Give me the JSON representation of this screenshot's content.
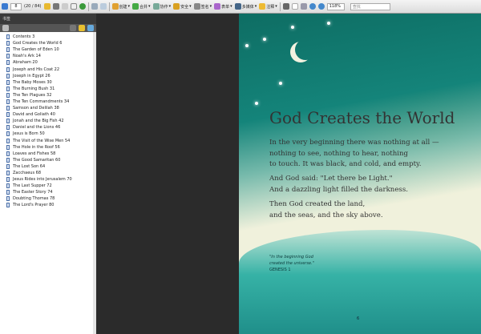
{
  "toolbar": {
    "page_current": "8",
    "page_total": "(20 / 84)",
    "create": "创建",
    "combine": "合并",
    "collaborate": "协作",
    "secure": "安全",
    "sign": "签名",
    "forms": "表单",
    "multimedia": "多媒体",
    "comment": "注释",
    "zoom": "118%",
    "find_placeholder": "查找"
  },
  "sidebar": {
    "title": "书签",
    "items": [
      "Contents 3",
      "God Creates the World 6",
      "The Garden of Eden 10",
      "Noah's Ark 14",
      "Abraham 20",
      "Joseph and His Coat 22",
      "Joseph in Egypt 26",
      "The Baby Moses 30",
      "The Burning Bush 31",
      "The Ten Plagues 32",
      "The Ten Commandments 34",
      "Samson and Delilah 38",
      "David and Goliath 40",
      "Jonah and the Big Fish 42",
      "Daniel and the Lions 46",
      "Jesus is Born 50",
      "The Visit of the Wise Men 54",
      "The Hole in the Roof 56",
      "Loaves and Fishes 58",
      "The Good Samaritan 60",
      "The Lost Son 64",
      "Zacchaeus 68",
      "Jesus Rides into Jerusalem 70",
      "The Last Supper 72",
      "The Easter Story 74",
      "Doubting Thomas 78",
      "The Lord's Prayer 80"
    ]
  },
  "page": {
    "title": "God Creates the World",
    "p1": [
      "In the very beginning there was nothing at all —",
      "nothing to see, nothing to hear, nothing",
      "to touch. It was black, and cold, and empty."
    ],
    "p2": [
      "And God said: \"Let there be Light.\"",
      "And a dazzling light filled the darkness."
    ],
    "p3": [
      "Then God created the land,",
      "and the seas, and the sky above."
    ],
    "caption": [
      "\"In the beginning God",
      "created the universe.\""
    ],
    "caption_ref": "GENESIS 1",
    "page_number": "6"
  }
}
